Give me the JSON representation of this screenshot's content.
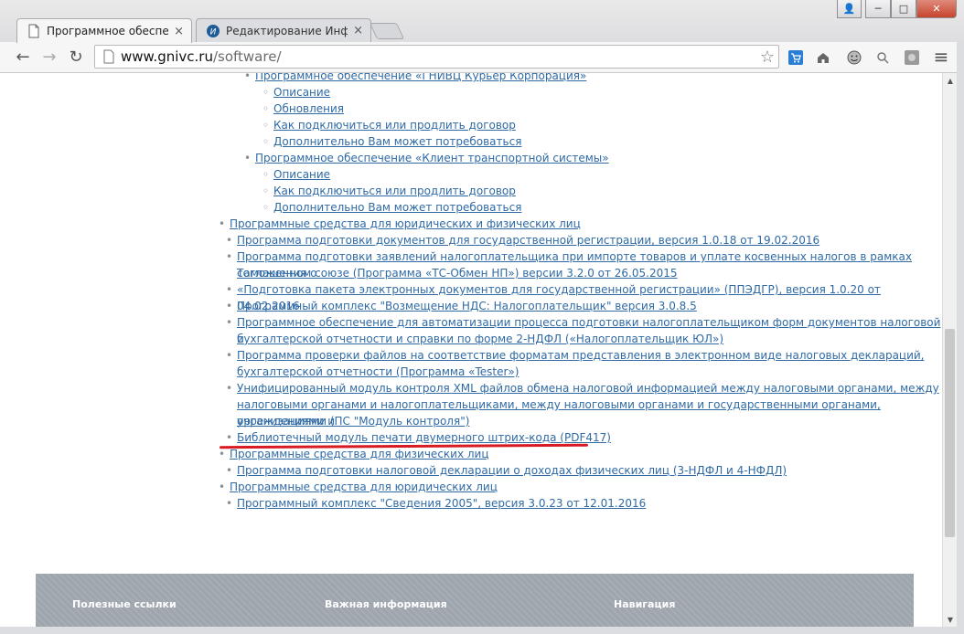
{
  "window": {
    "tabs": [
      {
        "label": "Программное обеспечен",
        "close": "×",
        "active": true
      },
      {
        "label": "Редактирование Инфо-Б",
        "close": "×",
        "active": false
      }
    ],
    "controls": {
      "user": "👤",
      "minimize": "─",
      "maximize": "□",
      "close": "✕"
    }
  },
  "toolbar": {
    "back": "←",
    "forward": "→",
    "reload": "↻",
    "url_host": "www.gnivc.ru",
    "url_path": "/software/",
    "star": "☆",
    "menu": "≡"
  },
  "content": {
    "items": [
      {
        "text": "Программное обеспечение «ГНИВЦ Курьер Корпорация»",
        "bullet": "•"
      },
      {
        "text": "Описание",
        "bullet": "◦"
      },
      {
        "text": "Обновления",
        "bullet": "◦"
      },
      {
        "text": "Как подключиться или продлить договор",
        "bullet": "◦"
      },
      {
        "text": "Дополнительно Вам может потребоваться",
        "bullet": "◦"
      },
      {
        "text": "Программное обеспечение «Клиент транспортной системы»",
        "bullet": "•"
      },
      {
        "text": "Описание",
        "bullet": "◦"
      },
      {
        "text": "Как подключиться или продлить договор",
        "bullet": "◦"
      },
      {
        "text": "Дополнительно Вам может потребоваться",
        "bullet": "◦"
      },
      {
        "text": "Программные средства для юридических и физических лиц",
        "bullet": "•"
      },
      {
        "text": "Программа подготовки документов для государственной регистрации, версия 1.0.18 от 19.02.2016",
        "bullet": "•"
      },
      {
        "text": "Программа подготовки заявлений налогоплательщика при импорте товаров и уплате косвенных налогов в рамках соглашения о",
        "bullet": "•"
      },
      {
        "text": "Таможенном союзе (Программа «ТС-Обмен НП») версии 3.2.0 от 26.05.2015",
        "bullet": ""
      },
      {
        "text": "«Подготовка пакета электронных документов для государственной регистрации» (ППЭДГР), версия 1.0.20 от 04.02.2016",
        "bullet": "•"
      },
      {
        "text": "Программный комплекс \"Возмещение НДС: Налогоплательщик\" версия 3.0.8.5",
        "bullet": "•"
      },
      {
        "text": "Программное обеспечение для автоматизации процесса подготовки налогоплательщиком форм документов налоговой и",
        "bullet": "•"
      },
      {
        "text": "бухгалтерской отчетности и справки по форме 2-НДФЛ («Налогоплательщик ЮЛ»)",
        "bullet": ""
      },
      {
        "text": "Программа проверки файлов на соответствие форматам представления в электронном виде налоговых деклараций,",
        "bullet": "•"
      },
      {
        "text": "бухгалтерской отчетности (Программа «Tester»)",
        "bullet": ""
      },
      {
        "text": "Унифицированный модуль контроля XML файлов обмена налоговой информацией между налоговыми органами, между",
        "bullet": "•"
      },
      {
        "text": "налоговыми органами и налогоплательщиками, между налоговыми органами и государственными органами, учреждениями и",
        "bullet": ""
      },
      {
        "text": "организациями (ПС \"Модуль контроля\")",
        "bullet": ""
      },
      {
        "text": "Библиотечный модуль печати двумерного штрих-кода (PDF417)",
        "bullet": "•"
      },
      {
        "text": "Программные средства для физических лиц",
        "bullet": "•"
      },
      {
        "text": "Программа подготовки налоговой декларации о доходах физических лиц (3-НДФЛ и 4-НФДЛ)",
        "bullet": "•"
      },
      {
        "text": "Программные средства для юридических лиц",
        "bullet": "•"
      },
      {
        "text": "Программный комплекс \"Сведения 2005\", версия 3.0.23 от 12.01.2016",
        "bullet": "•"
      }
    ]
  },
  "footer": {
    "col1": "Полезные ссылки",
    "col2": "Важная информация",
    "col3": "Навигация"
  },
  "scrollbar": {
    "up": "▲",
    "down": "▼"
  }
}
